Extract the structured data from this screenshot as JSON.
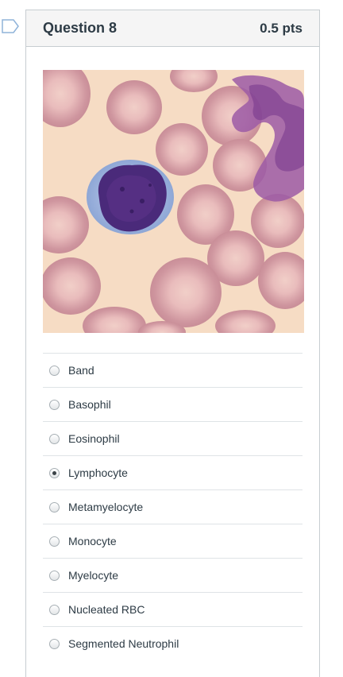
{
  "question": {
    "title": "Question 8",
    "points": "0.5 pts",
    "image_icon": "blood-smear-image"
  },
  "answers": [
    {
      "label": "Band",
      "selected": false
    },
    {
      "label": "Basophil",
      "selected": false
    },
    {
      "label": "Eosinophil",
      "selected": false
    },
    {
      "label": "Lymphocyte",
      "selected": true
    },
    {
      "label": "Metamyelocyte",
      "selected": false
    },
    {
      "label": "Monocyte",
      "selected": false
    },
    {
      "label": "Myelocyte",
      "selected": false
    },
    {
      "label": "Nucleated RBC",
      "selected": false
    },
    {
      "label": "Segmented Neutrophil",
      "selected": false
    }
  ],
  "colors": {
    "flag_stroke": "#8fb3d9",
    "background_plasma": "#f6dcc4",
    "rbc": "#d9a3a8",
    "nucleus": "#4a2a7a",
    "cytoplasm": "#9db3dc"
  }
}
